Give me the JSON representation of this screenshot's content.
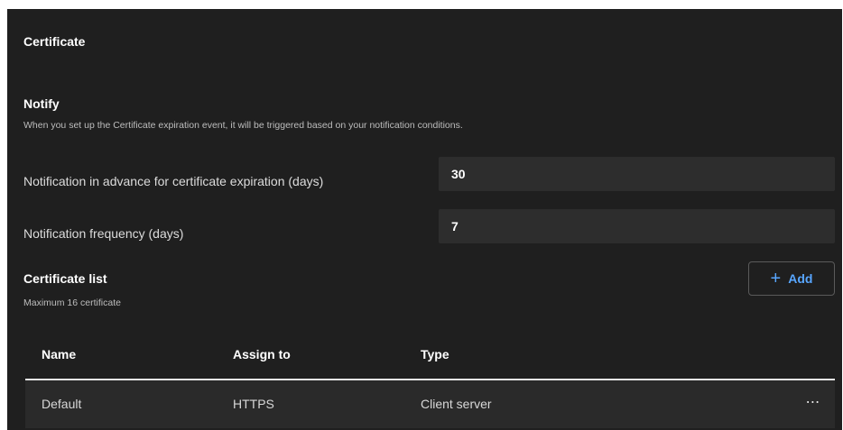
{
  "section": {
    "title": "Certificate"
  },
  "notify": {
    "title": "Notify",
    "description": "When you set up the Certificate expiration event, it will be triggered based on your notification conditions."
  },
  "form": {
    "advance_label": "Notification in advance for certificate expiration (days)",
    "advance_value": "30",
    "frequency_label": "Notification frequency (days)",
    "frequency_value": "7"
  },
  "certificate_list": {
    "title": "Certificate list",
    "subtitle": "Maximum 16 certificate",
    "add_button_label": "Add",
    "add_button_icon": "plus-icon",
    "accent_color": "#58a6ff",
    "columns": [
      "Name",
      "Assign to",
      "Type"
    ],
    "rows": [
      {
        "name": "Default",
        "assign_to": "HTTPS",
        "type": "Client server",
        "actions_icon": "more-horizontal-icon"
      }
    ]
  }
}
